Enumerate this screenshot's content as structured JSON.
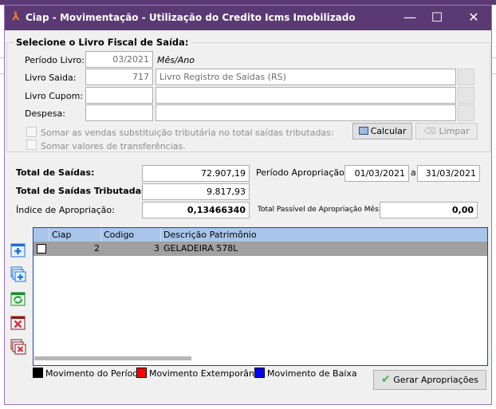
{
  "window": {
    "title": "Ciap - Movimentação - Utilização do Credito Icms Imobilizado",
    "minimize": "—",
    "maximize": "☐",
    "close": "✕"
  },
  "livro": {
    "group_title": "Selecione o Livro Fiscal de Saída:",
    "periodo_label": "Período Livro:",
    "periodo_value": "03/2021",
    "periodo_hint": "Mês/Ano",
    "saida_label": "Livro Saida:",
    "saida_code": "717",
    "saida_desc": "Livro Registro de Saídas (RS)",
    "cupom_label": "Livro Cupom:",
    "cupom_code": "",
    "cupom_desc": "",
    "despesa_label": "Despesa:",
    "despesa_code": "",
    "despesa_desc": "",
    "chk_substituicao": "Somar as vendas substituição tributária no total saídas tributadas:",
    "chk_transferencias": "Somar valores de transferências.",
    "calcular": "Calcular",
    "limpar": "Limpar"
  },
  "totais": {
    "total_saidas_label": "Total de Saídas:",
    "total_saidas": "72.907,19",
    "total_trib_label": "Total de Saídas Tributadas:",
    "total_trib": "9.817,93",
    "indice_label": "Índice de Apropriação:",
    "indice": "0,13466340",
    "periodo_label": "Período Apropriação:",
    "periodo_de": "01/03/2021",
    "periodo_sep": "a",
    "periodo_ate": "31/03/2021",
    "passivel_label": "Total Passível de Apropriação Mês:",
    "passivel": "0,00"
  },
  "grid": {
    "columns": [
      "Ciap",
      "Codigo",
      "Descrição Patrimônio"
    ],
    "rows": [
      {
        "checked": false,
        "ciap": "2",
        "codigo": "3",
        "descricao": "GELADEIRA 578L"
      }
    ]
  },
  "legend": [
    {
      "label": "Movimento do Período",
      "color": "#000000"
    },
    {
      "label": "Movimento Extemporâneo",
      "color": "#ff0000"
    },
    {
      "label": "Movimento de Baixa",
      "color": "#0000ff"
    }
  ],
  "gerar": "Gerar Apropriações"
}
